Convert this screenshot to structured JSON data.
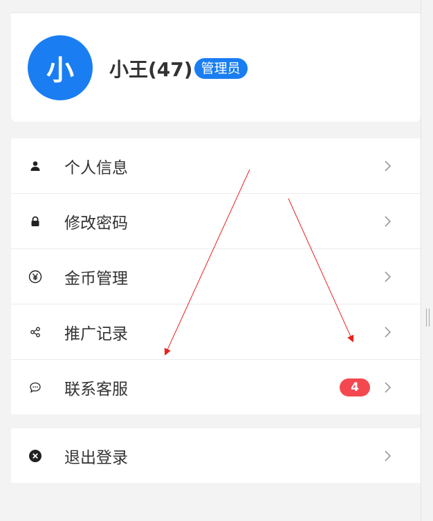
{
  "profile": {
    "avatar_text": "小",
    "name": "小王(47)",
    "role_badge": "管理员"
  },
  "menu": {
    "items": [
      {
        "label": "个人信息",
        "icon": "person-icon"
      },
      {
        "label": "修改密码",
        "icon": "lock-icon"
      },
      {
        "label": "金币管理",
        "icon": "yen-coin-icon"
      },
      {
        "label": "推广记录",
        "icon": "share-icon"
      },
      {
        "label": "联系客服",
        "icon": "chat-bubble-icon",
        "badge": "4"
      }
    ],
    "logout": {
      "label": "退出登录",
      "icon": "close-circle-icon"
    }
  },
  "colors": {
    "accent": "#1a7ef2",
    "badge_red": "#f5474f",
    "annotation_arrow": "#e8211c"
  }
}
